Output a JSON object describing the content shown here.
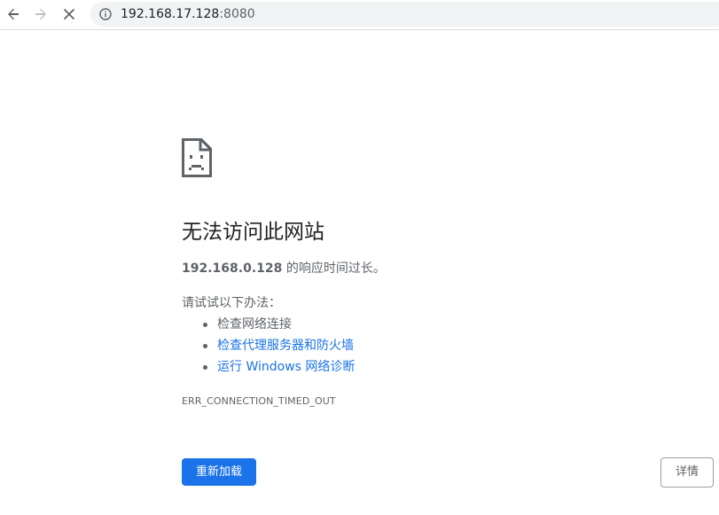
{
  "toolbar": {
    "back_icon": "arrow-left-icon",
    "forward_icon": "arrow-right-icon",
    "stop_icon": "close-icon",
    "info_icon": "info-icon",
    "url_host": "192.168.17.128",
    "url_port": ":8080"
  },
  "error_page": {
    "icon": "sad-page-icon",
    "title": "无法访问此网站",
    "summary_host": "192.168.0.128",
    "summary_text": " 的响应时间过长。",
    "suggest_heading": "请试试以下办法：",
    "suggestions": [
      {
        "label": "检查网络连接",
        "link": false
      },
      {
        "label": "检查代理服务器和防火墙",
        "link": true
      },
      {
        "label": "运行 Windows 网络诊断",
        "link": true
      }
    ],
    "error_code": "ERR_CONNECTION_TIMED_OUT",
    "reload_label": "重新加载",
    "details_label": "详情"
  },
  "colors": {
    "accent": "#1a73e8",
    "text_primary": "#202124",
    "text_secondary": "#5f6368",
    "omnibox_bg": "#f1f3f4"
  }
}
